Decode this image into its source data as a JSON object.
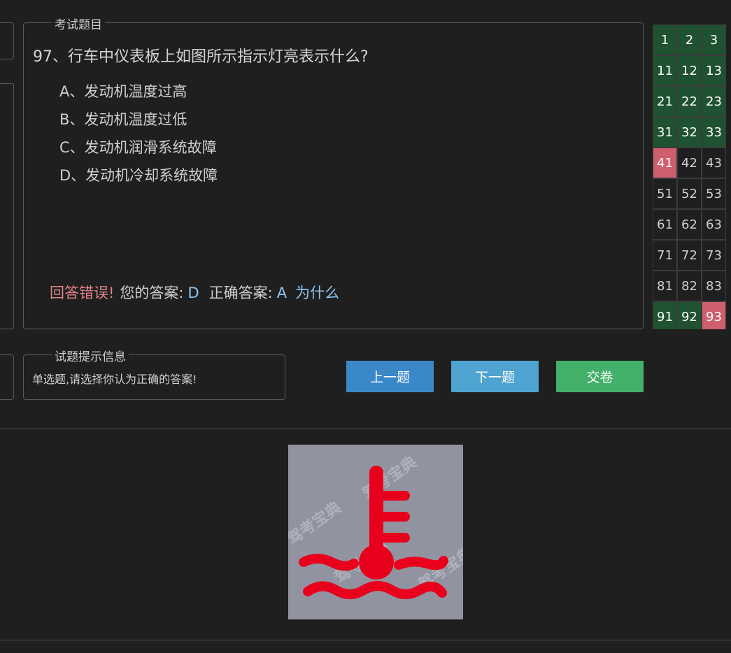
{
  "question_panel": {
    "legend": "考试题目",
    "question": "97、行车中仪表板上如图所示指示灯亮表示什么?",
    "options": [
      "A、发动机温度过高",
      "B、发动机温度过低",
      "C、发动机润滑系统故障",
      "D、发动机冷却系统故障"
    ],
    "result": {
      "status": "回答错误!",
      "your_answer_label": "您的答案:",
      "your_answer": "D",
      "correct_answer_label": "正确答案:",
      "correct_answer": "A",
      "why_link": "为什么"
    }
  },
  "hint_panel": {
    "legend": "试题提示信息",
    "text": "单选题,请选择你认为正确的答案!"
  },
  "buttons": {
    "prev": "上一题",
    "next": "下一题",
    "submit": "交卷"
  },
  "grid": {
    "columns_visible": 3,
    "rows": [
      {
        "numbers": [
          "1",
          "2",
          "3"
        ],
        "states": [
          "correct",
          "correct",
          "correct"
        ]
      },
      {
        "numbers": [
          "11",
          "12",
          "13"
        ],
        "states": [
          "correct",
          "correct",
          "correct"
        ]
      },
      {
        "numbers": [
          "21",
          "22",
          "23"
        ],
        "states": [
          "correct",
          "correct",
          "correct"
        ]
      },
      {
        "numbers": [
          "31",
          "32",
          "33"
        ],
        "states": [
          "correct",
          "correct",
          "correct"
        ]
      },
      {
        "numbers": [
          "41",
          "42",
          "43"
        ],
        "states": [
          "wrong",
          "plain",
          "plain"
        ]
      },
      {
        "numbers": [
          "51",
          "52",
          "53"
        ],
        "states": [
          "plain",
          "plain",
          "plain"
        ]
      },
      {
        "numbers": [
          "61",
          "62",
          "63"
        ],
        "states": [
          "plain",
          "plain",
          "plain"
        ]
      },
      {
        "numbers": [
          "71",
          "72",
          "73"
        ],
        "states": [
          "plain",
          "plain",
          "plain"
        ]
      },
      {
        "numbers": [
          "81",
          "82",
          "83"
        ],
        "states": [
          "plain",
          "plain",
          "plain"
        ]
      },
      {
        "numbers": [
          "91",
          "92",
          "93"
        ],
        "states": [
          "correct",
          "correct",
          "wrong"
        ]
      }
    ]
  },
  "sign_image": {
    "icon": "engine-coolant-temperature-warning-icon",
    "watermark": "驾考宝典",
    "colors": {
      "background": "#9194a0",
      "symbol": "#e8001c"
    }
  },
  "colors": {
    "background": "#1f1f1f",
    "correct_cell": "#1f5230",
    "wrong_cell": "#cf5f6e",
    "prev_button": "#3b88c9",
    "next_button": "#4fa3d1",
    "submit_button": "#43b06a",
    "wrong_text": "#e0828b",
    "answer_text": "#8ec5f0"
  }
}
